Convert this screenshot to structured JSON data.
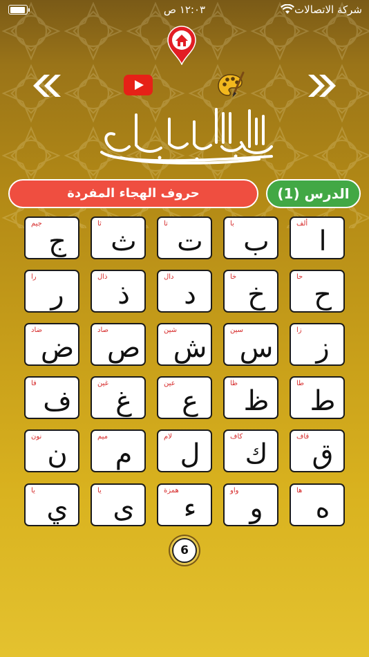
{
  "status_bar": {
    "carrier": "شركة الاتصالات",
    "time": "١٢:٠٣ ص"
  },
  "header": {
    "home_icon": "home-pin-icon",
    "prev_icon": "double-chevron-left-icon",
    "next_icon": "double-chevron-right-icon",
    "youtube_icon": "youtube-icon",
    "palette_icon": "palette-icon",
    "basmala_icon": "basmala-calligraphy-icon"
  },
  "lesson": {
    "label": "الدرس (1)",
    "title": "حروف الهجاء المفردة"
  },
  "colors": {
    "lesson_green": "#42a845",
    "title_red": "#ef4e40",
    "letter_name_red": "#d62c2c"
  },
  "letters": [
    {
      "glyph": "ا",
      "name": "ألف"
    },
    {
      "glyph": "ب",
      "name": "با"
    },
    {
      "glyph": "ت",
      "name": "تا"
    },
    {
      "glyph": "ث",
      "name": "ثا"
    },
    {
      "glyph": "ج",
      "name": "جيم"
    },
    {
      "glyph": "ح",
      "name": "حا"
    },
    {
      "glyph": "خ",
      "name": "خا"
    },
    {
      "glyph": "د",
      "name": "دال"
    },
    {
      "glyph": "ذ",
      "name": "ذال"
    },
    {
      "glyph": "ر",
      "name": "را"
    },
    {
      "glyph": "ز",
      "name": "زا"
    },
    {
      "glyph": "س",
      "name": "سين"
    },
    {
      "glyph": "ش",
      "name": "شين"
    },
    {
      "glyph": "ص",
      "name": "صاد"
    },
    {
      "glyph": "ض",
      "name": "ضاد"
    },
    {
      "glyph": "ط",
      "name": "طا"
    },
    {
      "glyph": "ظ",
      "name": "ظا"
    },
    {
      "glyph": "ع",
      "name": "عين"
    },
    {
      "glyph": "غ",
      "name": "غين"
    },
    {
      "glyph": "ف",
      "name": "فا"
    },
    {
      "glyph": "ق",
      "name": "قاف"
    },
    {
      "glyph": "ك",
      "name": "كاف"
    },
    {
      "glyph": "ل",
      "name": "لام"
    },
    {
      "glyph": "م",
      "name": "ميم"
    },
    {
      "glyph": "ن",
      "name": "نون"
    },
    {
      "glyph": "ه",
      "name": "ها"
    },
    {
      "glyph": "و",
      "name": "واو"
    },
    {
      "glyph": "ء",
      "name": "همزة"
    },
    {
      "glyph": "ى",
      "name": "يا"
    },
    {
      "glyph": "ي",
      "name": "يا"
    }
  ],
  "page_number": "6"
}
